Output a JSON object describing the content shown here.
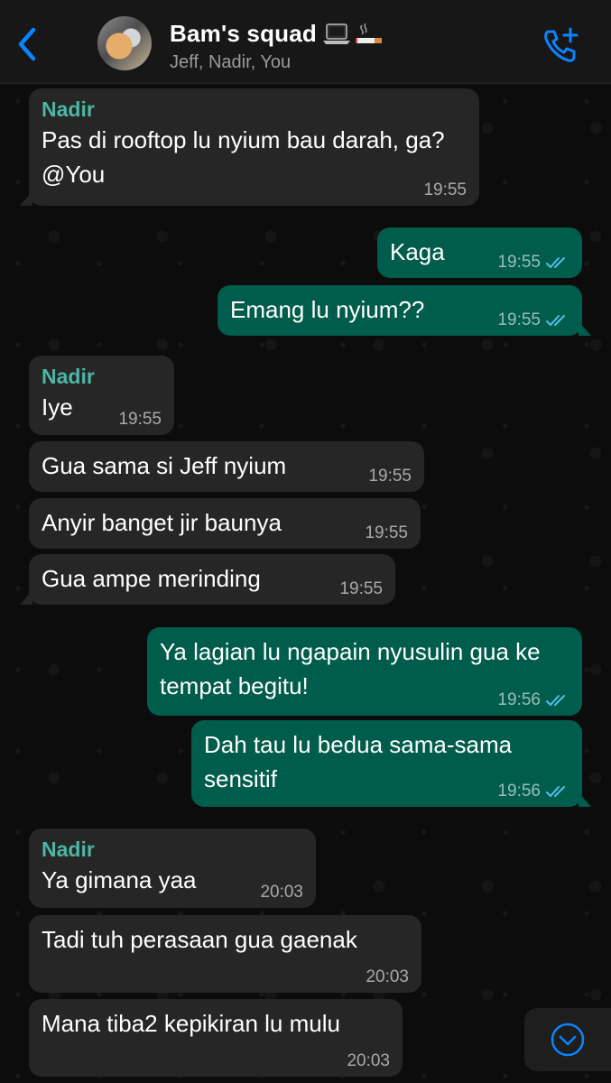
{
  "header": {
    "back_icon": "chevron-left-icon",
    "group_name": "Bam's squad",
    "title_emojis": [
      "laptop-icon",
      "cigarette-icon"
    ],
    "members": "Jeff, Nadir, You",
    "call_icon": "phone-plus-icon",
    "accent": "#0a84ff"
  },
  "colors": {
    "incoming_bubble": "#262626",
    "outgoing_bubble": "#005c4b",
    "sender_name": "#4db6a4",
    "read_ticks": "#53bdeb"
  },
  "messages": [
    {
      "dir": "in",
      "sender": "Nadir",
      "text": "Pas di rooftop lu nyium bau darah, ga? @You",
      "time": "19:55"
    },
    {
      "dir": "out",
      "text": "Kaga",
      "time": "19:55",
      "status": "read"
    },
    {
      "dir": "out",
      "text": "Emang lu nyium??",
      "time": "19:55",
      "status": "read"
    },
    {
      "dir": "in",
      "sender": "Nadir",
      "text": "Iye",
      "time": "19:55"
    },
    {
      "dir": "in",
      "text": "Gua sama si Jeff nyium",
      "time": "19:55"
    },
    {
      "dir": "in",
      "text": "Anyir banget jir baunya",
      "time": "19:55"
    },
    {
      "dir": "in",
      "text": "Gua ampe merinding",
      "time": "19:55"
    },
    {
      "dir": "out",
      "text": "Ya lagian lu ngapain nyusulin gua ke tempat begitu!",
      "time": "19:56",
      "status": "read"
    },
    {
      "dir": "out",
      "text": "Dah tau lu bedua sama-sama sensitif",
      "time": "19:56",
      "status": "read"
    },
    {
      "dir": "in",
      "sender": "Nadir",
      "text": "Ya gimana yaa",
      "time": "20:03"
    },
    {
      "dir": "in",
      "text": "Tadi tuh perasaan gua gaenak",
      "time": "20:03"
    },
    {
      "dir": "in",
      "text": "Mana tiba2 kepikiran lu mulu",
      "time": "20:03"
    }
  ],
  "scroll_button_icon": "chevron-down-circle-icon"
}
